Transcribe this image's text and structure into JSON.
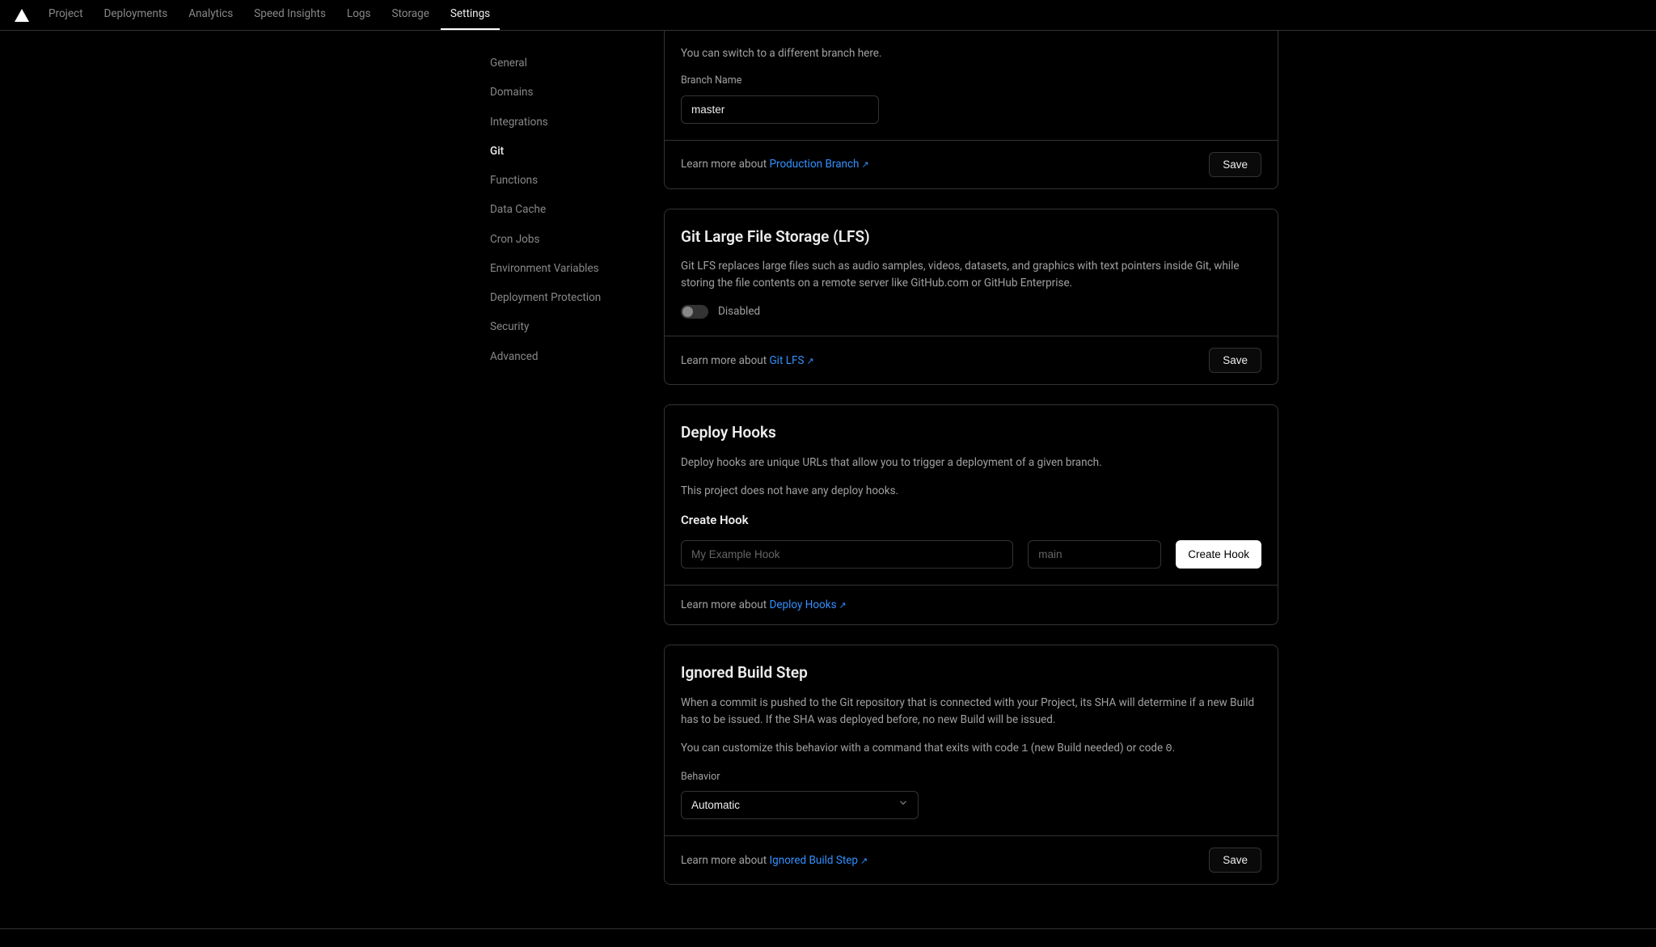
{
  "nav": {
    "tabs": [
      "Project",
      "Deployments",
      "Analytics",
      "Speed Insights",
      "Logs",
      "Storage",
      "Settings"
    ],
    "active": "Settings"
  },
  "sidebar": {
    "items": [
      "General",
      "Domains",
      "Integrations",
      "Git",
      "Functions",
      "Data Cache",
      "Cron Jobs",
      "Environment Variables",
      "Deployment Protection",
      "Security",
      "Advanced"
    ],
    "active": "Git"
  },
  "branch": {
    "desc": "You can switch to a different branch here.",
    "label": "Branch Name",
    "value": "master",
    "learn_prefix": "Learn more about ",
    "learn_link": "Production Branch",
    "save": "Save"
  },
  "lfs": {
    "title": "Git Large File Storage (LFS)",
    "desc": "Git LFS replaces large files such as audio samples, videos, datasets, and graphics with text pointers inside Git, while storing the file contents on a remote server like GitHub.com or GitHub Enterprise.",
    "toggle_label": "Disabled",
    "learn_prefix": "Learn more about ",
    "learn_link": "Git LFS",
    "save": "Save"
  },
  "hooks": {
    "title": "Deploy Hooks",
    "desc1": "Deploy hooks are unique URLs that allow you to trigger a deployment of a given branch.",
    "desc2": "This project does not have any deploy hooks.",
    "subtitle": "Create Hook",
    "name_placeholder": "My Example Hook",
    "branch_placeholder": "main",
    "create_btn": "Create Hook",
    "learn_prefix": "Learn more about ",
    "learn_link": "Deploy Hooks"
  },
  "ignored": {
    "title": "Ignored Build Step",
    "desc1": "When a commit is pushed to the Git repository that is connected with your Project, its SHA will determine if a new Build has to be issued. If the SHA was deployed before, no new Build will be issued.",
    "desc2_pre": "You can customize this behavior with a command that exits with code ",
    "desc2_code1": "1",
    "desc2_mid": " (new Build needed) or code ",
    "desc2_code2": "0",
    "desc2_post": ".",
    "behavior_label": "Behavior",
    "behavior_value": "Automatic",
    "learn_prefix": "Learn more about ",
    "learn_link": "Ignored Build Step",
    "save": "Save"
  }
}
